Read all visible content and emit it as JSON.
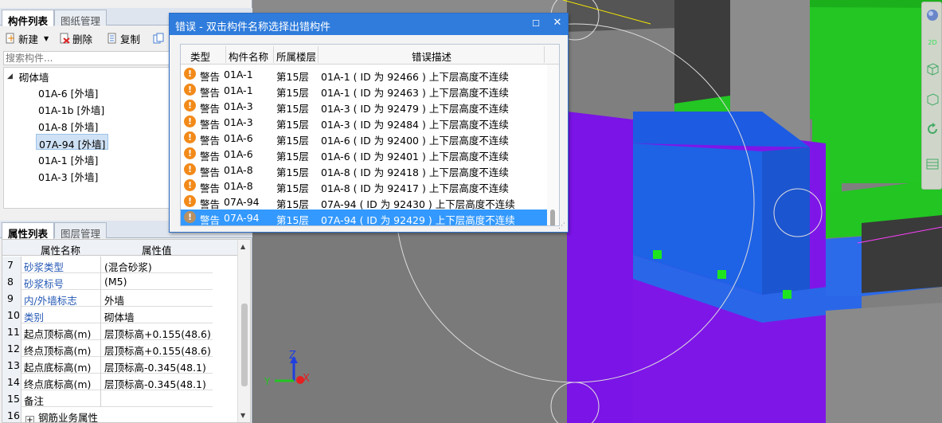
{
  "component_panel": {
    "tabs": [
      "构件列表",
      "图纸管理"
    ],
    "toolbar": {
      "new_label": "新建",
      "delete_label": "删除",
      "copy_label": "复制"
    },
    "search_placeholder": "搜索构件...",
    "tree": {
      "root": "砌体墙",
      "items": [
        "01A-6 [外墙]",
        "01A-1b [外墙]",
        "01A-8 [外墙]",
        "07A-94 [外墙]",
        "01A-1 [外墙]",
        "01A-3 [外墙]"
      ],
      "selected_index": 3
    }
  },
  "property_panel": {
    "tabs": [
      "属性列表",
      "图层管理"
    ],
    "header": {
      "name": "属性名称",
      "value": "属性值"
    },
    "rows": [
      {
        "num": "7",
        "name": "砂浆类型",
        "value": "(混合砂浆)"
      },
      {
        "num": "8",
        "name": "砂浆标号",
        "value": "(M5)"
      },
      {
        "num": "9",
        "name": "内/外墙标志",
        "value": "外墙"
      },
      {
        "num": "10",
        "name": "类别",
        "value": "砌体墙"
      },
      {
        "num": "11",
        "name": "起点顶标高(m)",
        "value": "层顶标高+0.155(48.6)"
      },
      {
        "num": "12",
        "name": "终点顶标高(m)",
        "value": "层顶标高+0.155(48.6)"
      },
      {
        "num": "13",
        "name": "起点底标高(m)",
        "value": "层顶标高-0.345(48.1)"
      },
      {
        "num": "14",
        "name": "终点底标高(m)",
        "value": "层顶标高-0.345(48.1)"
      },
      {
        "num": "15",
        "name": "备注",
        "value": ""
      },
      {
        "num": "16",
        "name": "钢筋业务属性",
        "value": ""
      }
    ]
  },
  "error_dialog": {
    "title": "错误 - 双击构件名称选择出错构件",
    "columns": [
      "类型",
      "构件名称",
      "所属楼层",
      "错误描述"
    ],
    "rows": [
      {
        "type": "警告",
        "name": "01A-1",
        "floor": "第15层",
        "desc": "01A-1 ( ID 为 92466 ) 上下层高度不连续"
      },
      {
        "type": "警告",
        "name": "01A-1",
        "floor": "第15层",
        "desc": "01A-1 ( ID 为 92463 ) 上下层高度不连续"
      },
      {
        "type": "警告",
        "name": "01A-3",
        "floor": "第15层",
        "desc": "01A-3 ( ID 为 92479 ) 上下层高度不连续"
      },
      {
        "type": "警告",
        "name": "01A-3",
        "floor": "第15层",
        "desc": "01A-3 ( ID 为 92484 ) 上下层高度不连续"
      },
      {
        "type": "警告",
        "name": "01A-6",
        "floor": "第15层",
        "desc": "01A-6 ( ID 为 92400 ) 上下层高度不连续"
      },
      {
        "type": "警告",
        "name": "01A-6",
        "floor": "第15层",
        "desc": "01A-6 ( ID 为 92401 ) 上下层高度不连续"
      },
      {
        "type": "警告",
        "name": "01A-8",
        "floor": "第15层",
        "desc": "01A-8 ( ID 为 92418 ) 上下层高度不连续"
      },
      {
        "type": "警告",
        "name": "01A-8",
        "floor": "第15层",
        "desc": "01A-8 ( ID 为 92417 ) 上下层高度不连续"
      },
      {
        "type": "警告",
        "name": "07A-94",
        "floor": "第15层",
        "desc": "07A-94 ( ID 为 92430 ) 上下层高度不连续"
      },
      {
        "type": "警告",
        "name": "07A-94",
        "floor": "第15层",
        "desc": "07A-94 ( ID 为 92429 ) 上下层高度不连续"
      }
    ],
    "selected_index": 9
  },
  "viewport": {
    "axis_labels": {
      "z": "Z",
      "x": "X",
      "y": "Y"
    },
    "colors": {
      "blue_wall": "#1f5fe0",
      "purple_wall": "#7f16e8",
      "green_wall": "#22c522",
      "grey": "#808080",
      "selection_point": "#1ee61e"
    }
  },
  "view_toolbar": {
    "mode_label": "2D"
  }
}
